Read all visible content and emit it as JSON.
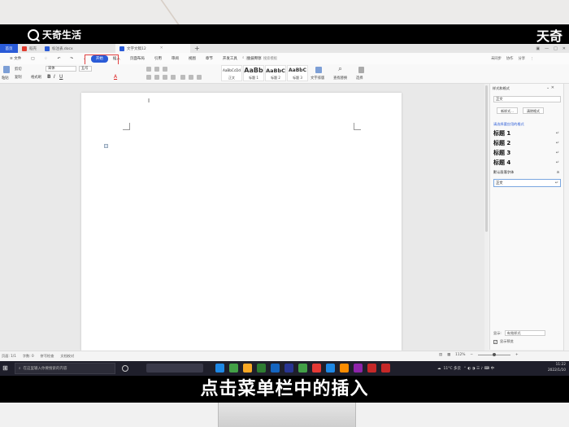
{
  "watermark": {
    "brand_left": "天奇生活",
    "brand_right": "天奇"
  },
  "tabs": [
    {
      "label": "首页"
    },
    {
      "label": "稻壳",
      "color": "#e03c2f"
    },
    {
      "label": "标注表.docx",
      "color": "#2a5bd7"
    },
    {
      "label": "文字文稿12",
      "color": "#2a5bd7"
    }
  ],
  "menu": {
    "items": [
      "≡ 文件",
      "□",
      "♢",
      "↶",
      "↷",
      "⌄",
      "开始",
      "插入",
      "页面布局",
      "引用",
      "审阅",
      "视图",
      "章节",
      "开发工具",
      "会员专享"
    ],
    "active_label": "开始",
    "search_placeholder": "查找命令、搜索模板",
    "right": [
      "未同步",
      "协作",
      "分享"
    ]
  },
  "toolbar": {
    "paste": "粘贴",
    "cut": "剪切",
    "copy": "复制",
    "format_painter": "格式刷",
    "font": "宋体",
    "size": "五号",
    "bold": "B",
    "italic": "I",
    "underline": "U",
    "font_color": "A",
    "styles": [
      {
        "sample": "AaBbCcDd",
        "label": "正文"
      },
      {
        "sample": "AaBb",
        "label": "标题 1"
      },
      {
        "sample": "AaBbC",
        "label": "标题 2"
      },
      {
        "sample": "AaBbC",
        "label": "标题 3"
      }
    ],
    "text_layout": "文字排版",
    "find_replace": "查找替换",
    "select": "选择"
  },
  "panel": {
    "title": "样式和格式",
    "current_style": "正文",
    "new_style_button": "新样式...",
    "clear_format_button": "清除格式",
    "apply_label": "请选择要应用的格式",
    "styles": [
      {
        "name": "标题 1"
      },
      {
        "name": "标题 2"
      },
      {
        "name": "标题 3"
      },
      {
        "name": "标题 4"
      },
      {
        "name": "默认段落字体"
      },
      {
        "name": "正文"
      }
    ],
    "show_label": "显示:",
    "show_value": "有效样式",
    "preview_label": "显示预览"
  },
  "status": {
    "page": "页面: 1/1",
    "words": "字数: 0",
    "spell": "拼写检查",
    "doc_check": "文档校对",
    "zoom": "112%"
  },
  "taskbar": {
    "search_placeholder": "在这里输入你要搜索的内容",
    "weather": "11°C 多云",
    "time": "11:22",
    "date": "2022/1/10"
  },
  "subtitle": "点击菜单栏中的插入"
}
